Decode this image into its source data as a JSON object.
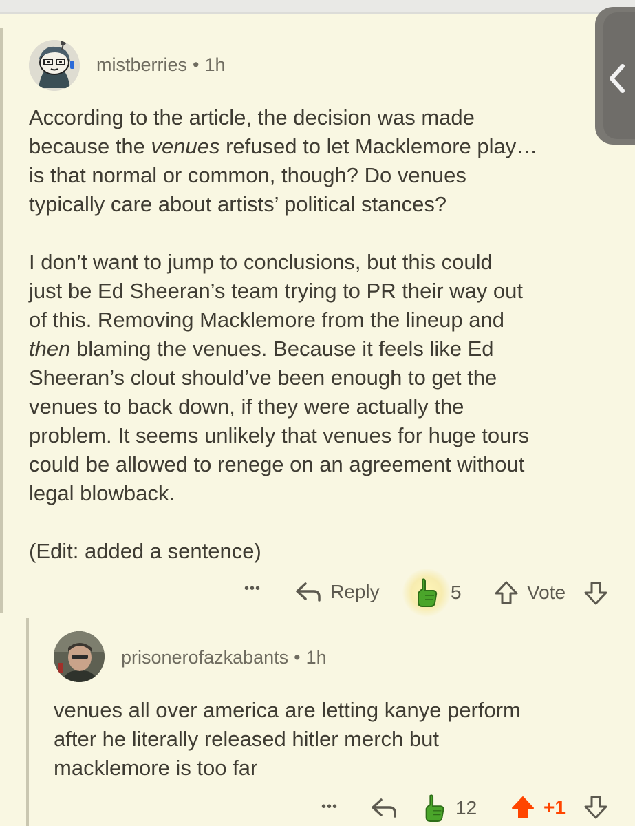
{
  "comment": {
    "username": "mistberries",
    "separator": "•",
    "time": "1h",
    "paragraphs": [
      [
        "According to the article, the decision was made",
        "because the ",
        "venues",
        " refused to let Macklemore play…",
        "is that normal or common, though? Do venues",
        "typically care about artists’ political stances?"
      ],
      [
        "I don’t want to jump to conclusions, but this could",
        "just be Ed Sheeran’s team trying to PR their way out",
        "of this. Removing Macklemore from the lineup and",
        "then",
        " blaming the venues. Because it feels like Ed",
        "Sheeran’s clout should’ve been enough to get the",
        "venues to back down, if they were actually the",
        "problem. It seems unlikely that venues for huge tours",
        "could be allowed to renege on an agreement without",
        "legal blowback."
      ],
      [
        "(Edit: added a sentence)"
      ]
    ],
    "actions": {
      "more": "•••",
      "reply": "Reply",
      "award_count": "5",
      "vote": "Vote"
    }
  },
  "reply": {
    "username": "prisonerofazkabants",
    "separator": "•",
    "time": "1h",
    "text_lines": [
      "venues all over america are letting kanye perform",
      "after he literally released hitler merch but",
      "macklemore is too far"
    ],
    "actions": {
      "more": "•••",
      "award_count": "12",
      "score": "+1"
    }
  },
  "colors": {
    "background": "#f9f7e2",
    "upvote_active": "#ff4500",
    "award_green": "#4aa52a"
  }
}
